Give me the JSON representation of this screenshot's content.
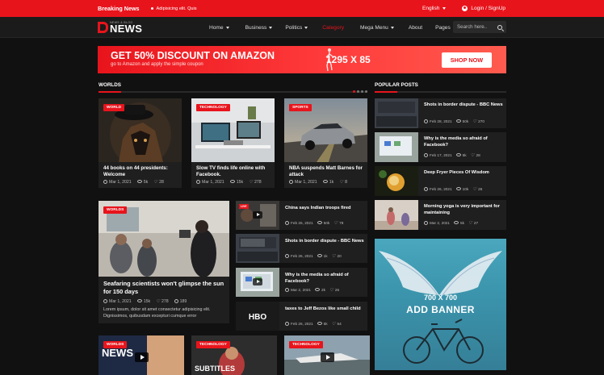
{
  "topbar": {
    "breaking_label": "Breaking News",
    "ticker_text": "Adipisicing elit. Quis",
    "language": "English",
    "login": "Login / SignUp"
  },
  "logo": {
    "sub": "NEWS & BLOG",
    "main": "NEWS"
  },
  "menu": [
    {
      "label": "Home",
      "dropdown": true,
      "active": false
    },
    {
      "label": "Business",
      "dropdown": true,
      "active": false
    },
    {
      "label": "Politics",
      "dropdown": true,
      "active": false
    },
    {
      "label": "Category",
      "dropdown": false,
      "active": true
    },
    {
      "label": "Mega Menu",
      "dropdown": true,
      "active": false
    },
    {
      "label": "About",
      "dropdown": false,
      "active": false
    },
    {
      "label": "Pages",
      "dropdown": true,
      "active": false
    }
  ],
  "search": {
    "placeholder": "Search here.."
  },
  "banner": {
    "title": "GET 50% DISCOUNT ON AMAZON",
    "subtitle": "go to Amazon and apply the simple coupon",
    "size": "1295 X 85",
    "button": "SHOP NOW"
  },
  "worlds": {
    "heading": "WORLDS",
    "cards": [
      {
        "badge": "WORLD",
        "title": "44 books on 44 presidents: Welcome",
        "date": "Mar 1, 2021",
        "views": "5k",
        "likes": "28"
      },
      {
        "badge": "TECHNOLOGY",
        "title": "Slow TV finds life online with Facebook.",
        "date": "Mar 1, 2021",
        "views": "15k",
        "likes": "278"
      },
      {
        "badge": "SPORTS",
        "title": "NBA suspends Matt Barnes for attack",
        "date": "Mar 1, 2021",
        "views": "1k",
        "likes": "8"
      }
    ],
    "feature": {
      "badge": "WORLDS",
      "title": "Seafaring scientists won't glimpse the sun for 150 days",
      "date": "Mar 1, 2021",
      "views": "15k",
      "likes": "278",
      "comments": "189",
      "excerpt": "Lorem ipsum, dolor sit amet consectetur adipisicing elit. Dignissimos, quibusdam excepturi cumque error"
    },
    "list": [
      {
        "title": "China says Indian troops fired",
        "date": "Feb 26, 2021",
        "views": "50k",
        "likes": "78"
      },
      {
        "title": "Shots in border dispute - BBC News",
        "date": "Feb 26, 2021",
        "views": "1k",
        "likes": "20"
      },
      {
        "title": "Why is the media so afraid of Facebook?",
        "date": "Mar 2, 2021",
        "views": "2k",
        "likes": "26"
      },
      {
        "title": "taxes to Jeff Bezos like small child",
        "date": "Feb 26, 2021",
        "views": "5k",
        "likes": "54"
      }
    ]
  },
  "popular": {
    "heading": "POPULAR POSTS",
    "items": [
      {
        "title": "Shots in border dispute - BBC News",
        "date": "Feb 28, 2021",
        "views": "50k",
        "likes": "270"
      },
      {
        "title": "Why is the media so afraid of Facebook?",
        "date": "Feb 17, 2021",
        "views": "5k",
        "likes": "28"
      },
      {
        "title": "Deep Fryer Pieces Of Wisdom",
        "date": "Feb 26, 2021",
        "views": "10k",
        "likes": "26"
      },
      {
        "title": "Morning yoga is very important for maintaining",
        "date": "Mar 2, 2021",
        "views": "5k",
        "likes": "27"
      }
    ]
  },
  "ad": {
    "size": "700 X 700",
    "text": "ADD BANNER"
  },
  "videos": [
    {
      "badge": "WORLDS"
    },
    {
      "badge": "TECHNOLOGY"
    },
    {
      "badge": "TECHNOLOGY"
    }
  ],
  "colors": {
    "accent": "#e8141c",
    "background": "#111111",
    "card": "#1f1f1f"
  }
}
